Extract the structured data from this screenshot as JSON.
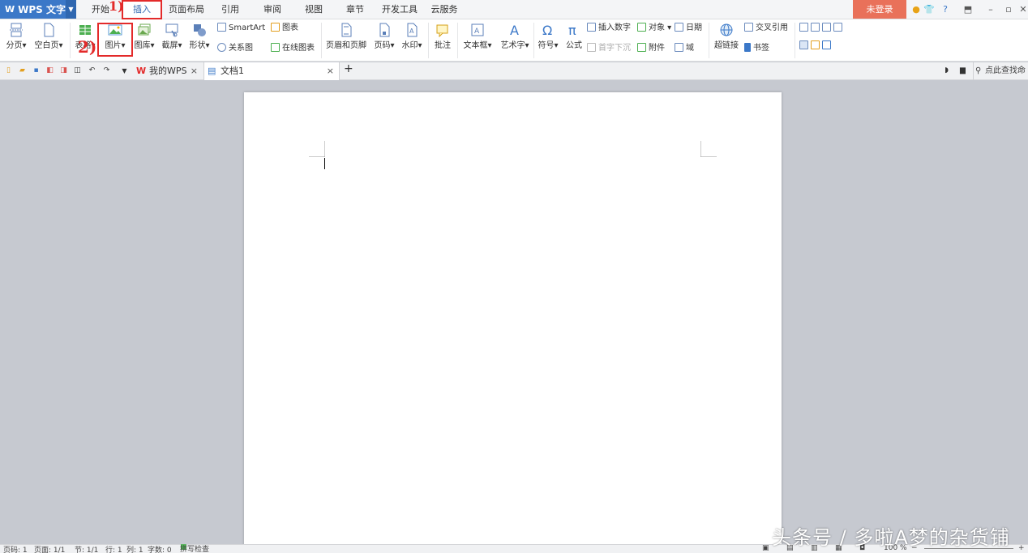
{
  "app": {
    "title": "WPS 文字"
  },
  "menu": {
    "tabs": [
      {
        "label": "开始"
      },
      {
        "label": "插入"
      },
      {
        "label": "页面布局"
      },
      {
        "label": "引用"
      },
      {
        "label": "审阅"
      },
      {
        "label": "视图"
      },
      {
        "label": "章节"
      },
      {
        "label": "开发工具"
      },
      {
        "label": "云服务"
      }
    ],
    "active": "插入",
    "login_label": "未登录"
  },
  "ribbon": {
    "page_break": "分页",
    "blank_page": "空白页",
    "table": "表格",
    "picture": "图片",
    "gallery": "图库",
    "screenshot": "截屏",
    "shapes": "形状",
    "smartart": "SmartArt",
    "chart": "图表",
    "relation": "关系图",
    "online_chart": "在线图表",
    "header_footer": "页眉和页脚",
    "page_number": "页码",
    "watermark": "水印",
    "comment": "批注",
    "textbox": "文本框",
    "wordart": "艺术字",
    "symbol": "符号",
    "formula": "公式",
    "insert_number": "插入数字",
    "dropcap": "首字下沉",
    "object": "对象",
    "attachment": "附件",
    "date": "日期",
    "field": "域",
    "hyperlink": "超链接",
    "cross_ref": "交叉引用",
    "bookmark": "书签"
  },
  "tabs": {
    "my_wps": "我的WPS",
    "doc1": "文档1",
    "find_placeholder": "点此查找命"
  },
  "status": {
    "page_num": "页码: 1",
    "pages": "页面: 1/1",
    "section": "节: 1/1",
    "row": "行: 1",
    "col": "列: 1",
    "words": "字数: 0",
    "spell": "拼写检查",
    "zoom": "100 %"
  },
  "annotations": {
    "step1": "1)",
    "step2": "2)"
  },
  "watermark_text": "头条号 / 多啦A梦的杂货铺"
}
